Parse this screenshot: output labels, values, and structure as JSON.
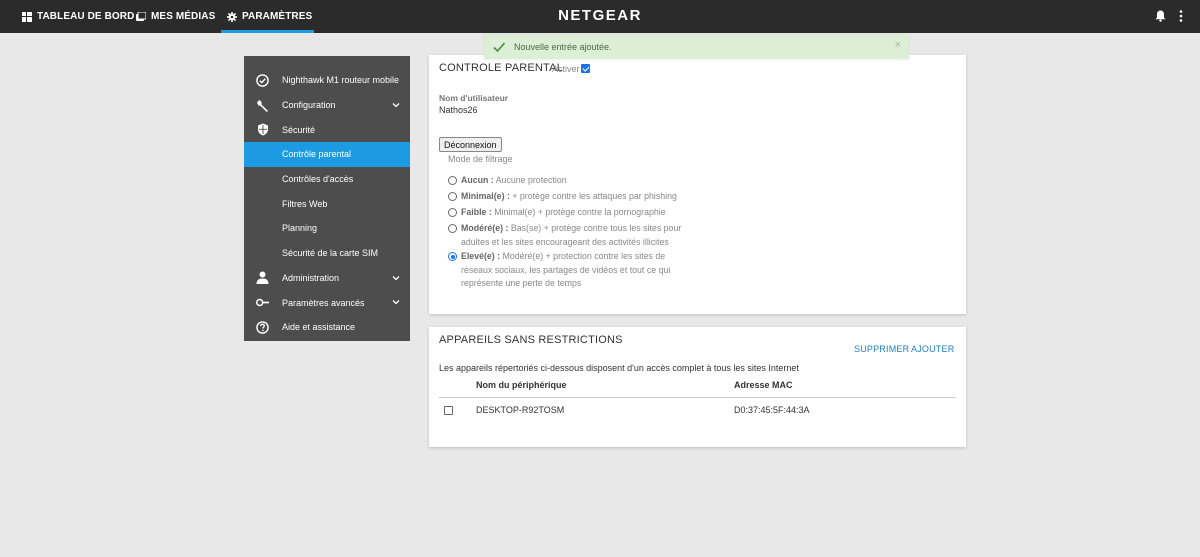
{
  "topbar": {
    "nav": [
      {
        "label": "TABLEAU DE BORD",
        "icon": "grid-icon"
      },
      {
        "label": "MES MÉDIAS",
        "icon": "media-icon"
      },
      {
        "label": "PARAMÈTRES",
        "icon": "gear-icon"
      }
    ],
    "brand": "NETGEAR",
    "accent_color": "#1d9be2"
  },
  "toast": {
    "message": "Nouvelle entrée ajoutée.",
    "close": "×"
  },
  "sidebar": {
    "items": [
      {
        "label": "Nighthawk M1 routeur mobile",
        "icon": "check-circle-icon"
      },
      {
        "label": "Configuration",
        "icon": "wrench-icon"
      },
      {
        "label": "Sécurité",
        "icon": "shield-icon"
      },
      {
        "label": "Contrôle parental"
      },
      {
        "label": "Contrôles d'accès"
      },
      {
        "label": "Filtres Web"
      },
      {
        "label": "Planning"
      },
      {
        "label": "Sécurité de la carte SIM"
      },
      {
        "label": "Administration",
        "icon": "person-icon"
      },
      {
        "label": "Paramètres avancés",
        "icon": "key-icon"
      },
      {
        "label": "Aide et assistance",
        "icon": "help-icon"
      }
    ]
  },
  "parental": {
    "title": "CONTROLE PARENTAL",
    "enable_label": "Activer",
    "enabled": true,
    "username_label": "Nom d'utilisateur",
    "username": "Nathos26",
    "logout_button": "Déconnexion",
    "filter_mode_label": "Mode de filtrage",
    "options": [
      {
        "name": "Aucun :",
        "desc": " Aucune protection",
        "selected": false
      },
      {
        "name": "Minimal(e) :",
        "desc": " + protège contre les attaques par phishing",
        "selected": false
      },
      {
        "name": "Faible :",
        "desc": " Minimal(e) + protège contre la pornographie",
        "selected": false
      },
      {
        "name": "Modéré(e) :",
        "desc": " Bas(se) + protège contre tous les sites pour adultes et les sites encourageant des activités illicites",
        "selected": false
      },
      {
        "name": "Elevé(e) :",
        "desc": " Modéré(e) + protection contre les sites de réseaux sociaux, les partages de vidéos et tout ce qui représente une perte de temps",
        "selected": true
      }
    ]
  },
  "unrestricted": {
    "title": "APPAREILS SANS RESTRICTIONS",
    "delete_link": "SUPPRIMER",
    "add_link": "AJOUTER",
    "description": "Les appareils répertoriés ci-dessous disposent d'un accès complet à tous les sites Internet",
    "columns": [
      "Nom du périphérique",
      "Adresse MAC"
    ],
    "rows": [
      {
        "name": "DESKTOP-R92TOSM",
        "mac": "D0:37:45:5F:44:3A",
        "checked": false
      }
    ]
  }
}
